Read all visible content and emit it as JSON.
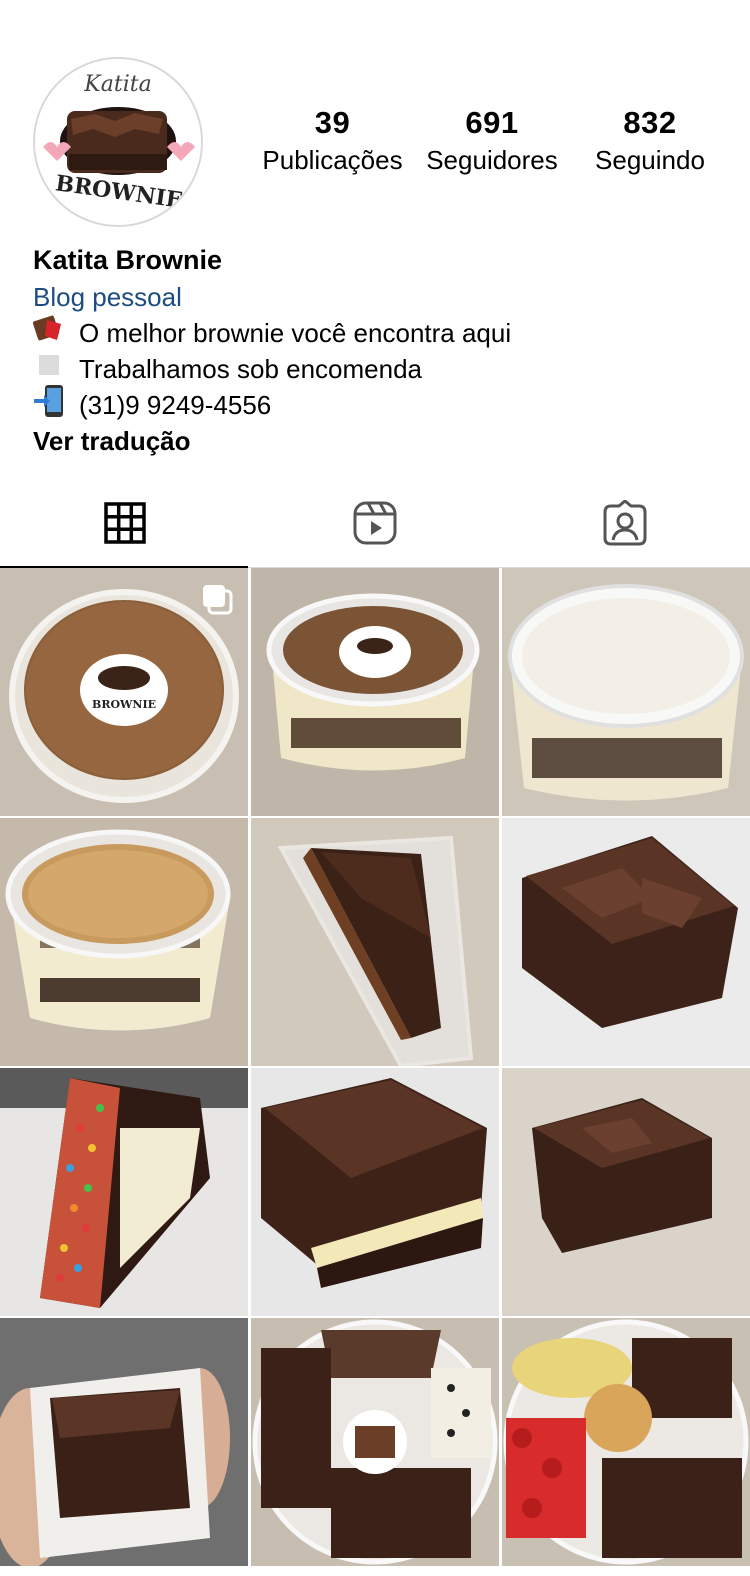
{
  "profile": {
    "avatar_icon": "katita-brownie-logo",
    "logo_text_top": "Katita",
    "logo_text_bottom": "BROWNIE",
    "stats": [
      {
        "value": "39",
        "label": "Publicações"
      },
      {
        "value": "691",
        "label": "Seguidores"
      },
      {
        "value": "832",
        "label": "Seguindo"
      }
    ],
    "name": "Katita Brownie",
    "category": "Blog pessoal",
    "bio_lines": [
      {
        "icon": "chocolate-bar-emoji",
        "text": "O melhor brownie você encontra aqui"
      },
      {
        "icon": "white-square-emoji",
        "text": "Trabalhamos sob encomenda"
      },
      {
        "icon": "mobile-phone-arrow-emoji",
        "text": "(31)9 9249-4556"
      }
    ],
    "translate_label": "Ver tradução"
  },
  "tabs": [
    {
      "icon": "grid-icon",
      "active": true
    },
    {
      "icon": "reels-icon",
      "active": false
    },
    {
      "icon": "tagged-icon",
      "active": false
    }
  ],
  "posts": [
    {
      "subject": "brownie-pot-nuts-label",
      "multi": true
    },
    {
      "subject": "brownie-pot-side-label",
      "multi": false
    },
    {
      "subject": "coconut-pot",
      "multi": false
    },
    {
      "subject": "nut-pot-layers",
      "multi": false
    },
    {
      "subject": "brownie-slice-box",
      "multi": false
    },
    {
      "subject": "brownie-square-plate",
      "multi": false
    },
    {
      "subject": "sprinkle-brownie-slice",
      "multi": false
    },
    {
      "subject": "filled-brownie",
      "multi": false
    },
    {
      "subject": "brownie-square-marble",
      "multi": false
    },
    {
      "subject": "brownie-in-hand",
      "multi": false
    },
    {
      "subject": "brownie-platter",
      "multi": false
    },
    {
      "subject": "brownie-strawberry-platter",
      "multi": false
    }
  ],
  "colors": {
    "category_link": "#1d4c80",
    "brownie": "#4a2a1c",
    "plate": "#ececec"
  }
}
